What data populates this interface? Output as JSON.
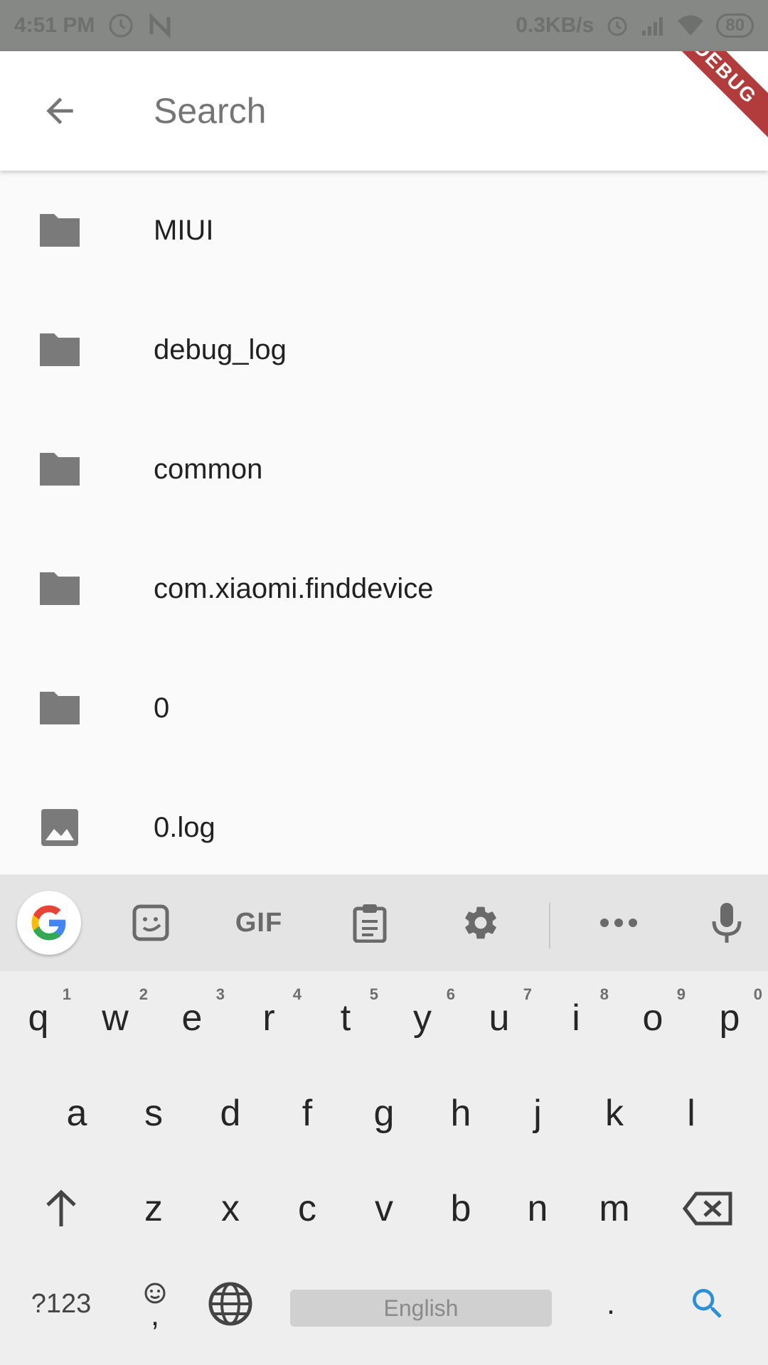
{
  "status_bar": {
    "time": "4:51 PM",
    "net_speed": "0.3KB/s",
    "battery": "80"
  },
  "app_bar": {
    "search_placeholder": "Search",
    "debug_banner": "DEBUG"
  },
  "files": [
    {
      "name": "MIUI",
      "type": "folder"
    },
    {
      "name": "debug_log",
      "type": "folder"
    },
    {
      "name": "common",
      "type": "folder"
    },
    {
      "name": "com.xiaomi.finddevice",
      "type": "folder"
    },
    {
      "name": "0",
      "type": "folder"
    },
    {
      "name": "0.log",
      "type": "image"
    }
  ],
  "keyboard": {
    "toolbar": {
      "gif_label": "GIF"
    },
    "row1": [
      {
        "key": "q",
        "hint": "1"
      },
      {
        "key": "w",
        "hint": "2"
      },
      {
        "key": "e",
        "hint": "3"
      },
      {
        "key": "r",
        "hint": "4"
      },
      {
        "key": "t",
        "hint": "5"
      },
      {
        "key": "y",
        "hint": "6"
      },
      {
        "key": "u",
        "hint": "7"
      },
      {
        "key": "i",
        "hint": "8"
      },
      {
        "key": "o",
        "hint": "9"
      },
      {
        "key": "p",
        "hint": "0"
      }
    ],
    "row2": [
      "a",
      "s",
      "d",
      "f",
      "g",
      "h",
      "j",
      "k",
      "l"
    ],
    "row3": [
      "z",
      "x",
      "c",
      "v",
      "b",
      "n",
      "m"
    ],
    "bottom": {
      "symbols_label": "?123",
      "emoji_comma": ",",
      "space_label": "English",
      "period_label": "."
    }
  }
}
